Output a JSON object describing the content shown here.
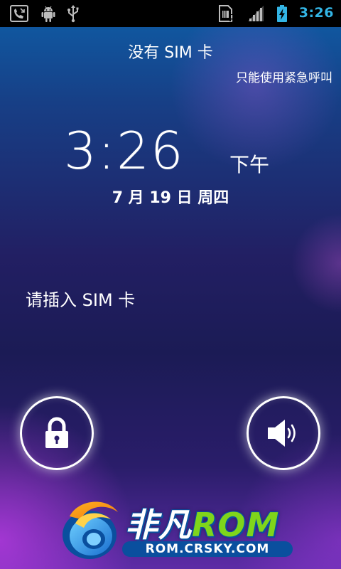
{
  "status_bar": {
    "time": "3:26",
    "time_color": "#33b5e5",
    "left_icons": [
      "missed-call-icon",
      "android-debug-icon",
      "usb-icon"
    ],
    "right_icons": [
      "no-sim-icon",
      "signal-icon",
      "battery-charging-icon"
    ]
  },
  "lockscreen": {
    "carrier": "没有 SIM 卡",
    "emergency_note": "只能使用紧急呼叫",
    "clock_time": "3:26",
    "clock_ampm": "下午",
    "date": "7 月 19 日 周四",
    "sim_message": "请插入 SIM 卡",
    "unlock_icon": "lock-icon",
    "sound_icon": "speaker-icon"
  },
  "watermark": {
    "title_cn": "非凡",
    "title_rom": "ROM",
    "url": "ROM.CRSKY.COM",
    "accent_green": "#7fd51b",
    "accent_blue": "#0a4f9e"
  }
}
